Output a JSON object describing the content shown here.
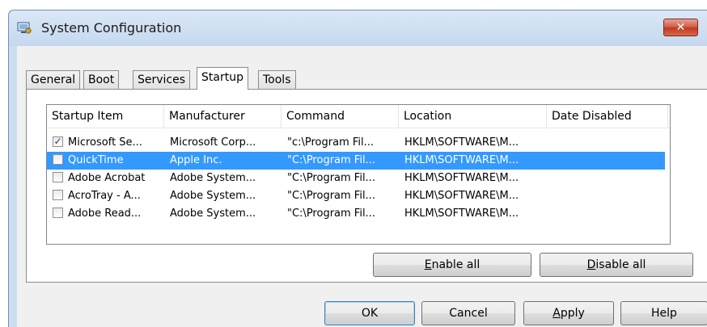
{
  "window": {
    "title": "System Configuration",
    "close_glyph": "✕"
  },
  "tabs": [
    {
      "label": "General",
      "active": false
    },
    {
      "label": "Boot",
      "active": false
    },
    {
      "label": "Services",
      "active": false
    },
    {
      "label": "Startup",
      "active": true
    },
    {
      "label": "Tools",
      "active": false
    }
  ],
  "startup_list": {
    "columns": [
      "Startup Item",
      "Manufacturer",
      "Command",
      "Location",
      "Date Disabled"
    ],
    "rows": [
      {
        "checked": true,
        "item": "Microsoft Se...",
        "manufacturer": "Microsoft Corp...",
        "command": "\"c:\\Program Fil...",
        "location": "HKLM\\SOFTWARE\\M...",
        "date_disabled": ""
      },
      {
        "checked": false,
        "item": "QuickTime",
        "manufacturer": "Apple Inc.",
        "command": "\"C:\\Program Fil...",
        "location": "HKLM\\SOFTWARE\\M...",
        "date_disabled": "",
        "selected": true
      },
      {
        "checked": false,
        "item": "Adobe Acrobat",
        "manufacturer": "Adobe System...",
        "command": "\"C:\\Program Fil...",
        "location": "HKLM\\SOFTWARE\\M...",
        "date_disabled": ""
      },
      {
        "checked": false,
        "item": "AcroTray - A...",
        "manufacturer": "Adobe System...",
        "command": "\"C:\\Program Fil...",
        "location": "HKLM\\SOFTWARE\\M...",
        "date_disabled": ""
      },
      {
        "checked": false,
        "item": "Adobe Read...",
        "manufacturer": "Adobe System...",
        "command": "\"C:\\Program Fil...",
        "location": "HKLM\\SOFTWARE\\M...",
        "date_disabled": ""
      }
    ]
  },
  "buttons": {
    "enable_all_mnemonic": "E",
    "enable_all_rest": "nable all",
    "disable_all_mnemonic": "D",
    "disable_all_rest": "isable all",
    "ok": "OK",
    "cancel": "Cancel",
    "apply_mnemonic": "A",
    "apply_rest": "pply",
    "help": "Help"
  },
  "icons": {
    "title_icon": "system-configuration-icon",
    "check_glyph": "✓"
  },
  "colors": {
    "selection": "#3399ff",
    "window_frame": "#cdddf0",
    "close_button": "#c0391f"
  }
}
